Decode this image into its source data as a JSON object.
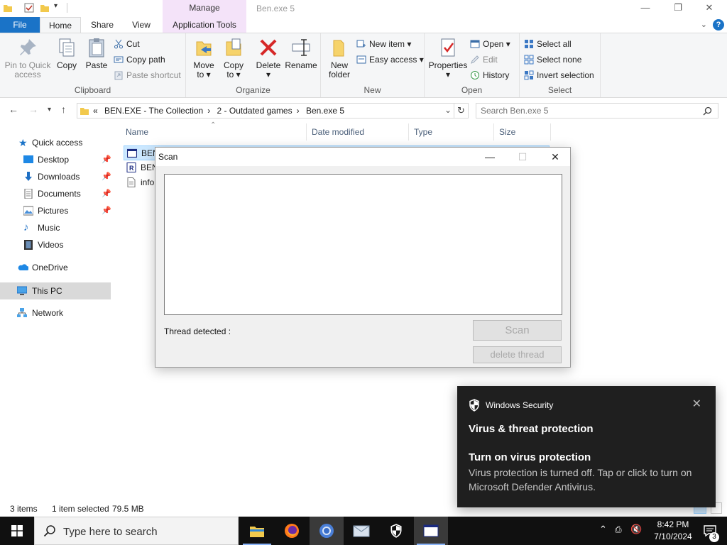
{
  "window": {
    "title": "Ben.exe 5",
    "context_tab": "Manage"
  },
  "ribbon_tabs": [
    "File",
    "Home",
    "Share",
    "View",
    "Application Tools"
  ],
  "ribbon": {
    "clipboard": {
      "label": "Clipboard",
      "pin": "Pin to Quick access",
      "pin_l1": "Pin to Quick",
      "pin_l2": "access",
      "copy": "Copy",
      "paste": "Paste",
      "cut": "Cut",
      "copy_path": "Copy path",
      "paste_shortcut": "Paste shortcut"
    },
    "organize": {
      "label": "Organize",
      "move_l1": "Move",
      "move_l2": "to",
      "copy_l1": "Copy",
      "copy_l2": "to",
      "delete": "Delete",
      "rename": "Rename"
    },
    "new": {
      "label": "New",
      "folder_l1": "New",
      "folder_l2": "folder",
      "new_item": "New item",
      "easy_access": "Easy access"
    },
    "open": {
      "label": "Open",
      "properties": "Properties",
      "open": "Open",
      "edit": "Edit",
      "history": "History"
    },
    "select": {
      "label": "Select",
      "select_all": "Select all",
      "select_none": "Select none",
      "invert": "Invert selection"
    }
  },
  "address": {
    "prefix": "«",
    "crumbs": [
      "BEN.EXE - The Collection",
      "2 - Outdated games",
      "Ben.exe 5"
    ],
    "search_placeholder": "Search Ben.exe 5"
  },
  "sidebar": {
    "items": [
      {
        "label": "Quick access"
      },
      {
        "label": "Desktop"
      },
      {
        "label": "Downloads"
      },
      {
        "label": "Documents"
      },
      {
        "label": "Pictures"
      },
      {
        "label": "Music"
      },
      {
        "label": "Videos"
      },
      {
        "label": "OneDrive"
      },
      {
        "label": "This PC"
      },
      {
        "label": "Network"
      }
    ]
  },
  "filelist": {
    "columns": [
      "Name",
      "Date modified",
      "Type",
      "Size"
    ],
    "rows": [
      {
        "name": "BEN"
      },
      {
        "name": "BEN"
      },
      {
        "name": "info"
      }
    ]
  },
  "status": {
    "items": "3 items",
    "selected": "1 item selected",
    "size": "79.5 MB"
  },
  "scan_dialog": {
    "title": "Scan",
    "status_label": "Thread detected :",
    "scan_button": "Scan",
    "delete_button": "delete thread"
  },
  "toast": {
    "app": "Windows Security",
    "heading": "Virus & threat protection",
    "subheading": "Turn on virus protection",
    "body": "Virus protection is turned off. Tap or click to turn on Microsoft Defender Antivirus."
  },
  "taskbar": {
    "search_placeholder": "Type here to search",
    "time": "8:42 PM",
    "date": "7/10/2024",
    "notifications": "3"
  },
  "colors": {
    "accent": "#1a73c7",
    "context_tab": "#f4e3f9",
    "toast_bg": "#1f1f1f",
    "taskbar_bg": "#101010",
    "selection": "#cce8ff"
  }
}
